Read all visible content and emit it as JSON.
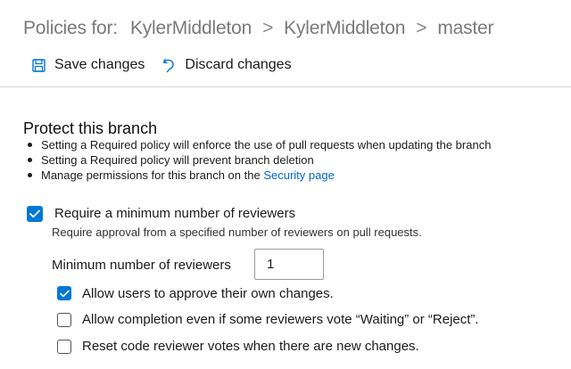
{
  "breadcrumb": {
    "lead": "Policies for:",
    "items": [
      "KylerMiddleton",
      "KylerMiddleton",
      "master"
    ],
    "separator": ">"
  },
  "toolbar": {
    "save_label": "Save changes",
    "save_icon": "floppy-disk-icon",
    "discard_label": "Discard changes",
    "discard_icon": "undo-icon"
  },
  "protect": {
    "title": "Protect this branch",
    "bullets": [
      "Setting a Required policy will enforce the use of pull requests when updating the branch",
      "Setting a Required policy will prevent branch deletion"
    ],
    "bullet3_prefix": "Manage permissions for this branch on the ",
    "bullet3_link": "Security page"
  },
  "reviewers": {
    "checked": true,
    "label": "Require a minimum number of reviewers",
    "description": "Require approval from a specified number of reviewers on pull requests.",
    "min_label": "Minimum number of reviewers",
    "min_value": "1",
    "options": [
      {
        "label": "Allow users to approve their own changes.",
        "checked": true
      },
      {
        "label": "Allow completion even if some reviewers vote “Waiting” or “Reject”.",
        "checked": false
      },
      {
        "label": "Reset code reviewer votes when there are new changes.",
        "checked": false
      }
    ]
  },
  "colors": {
    "accent": "#0078d4",
    "link": "#0066c7",
    "breadcrumb_text": "#7a7a7a"
  }
}
